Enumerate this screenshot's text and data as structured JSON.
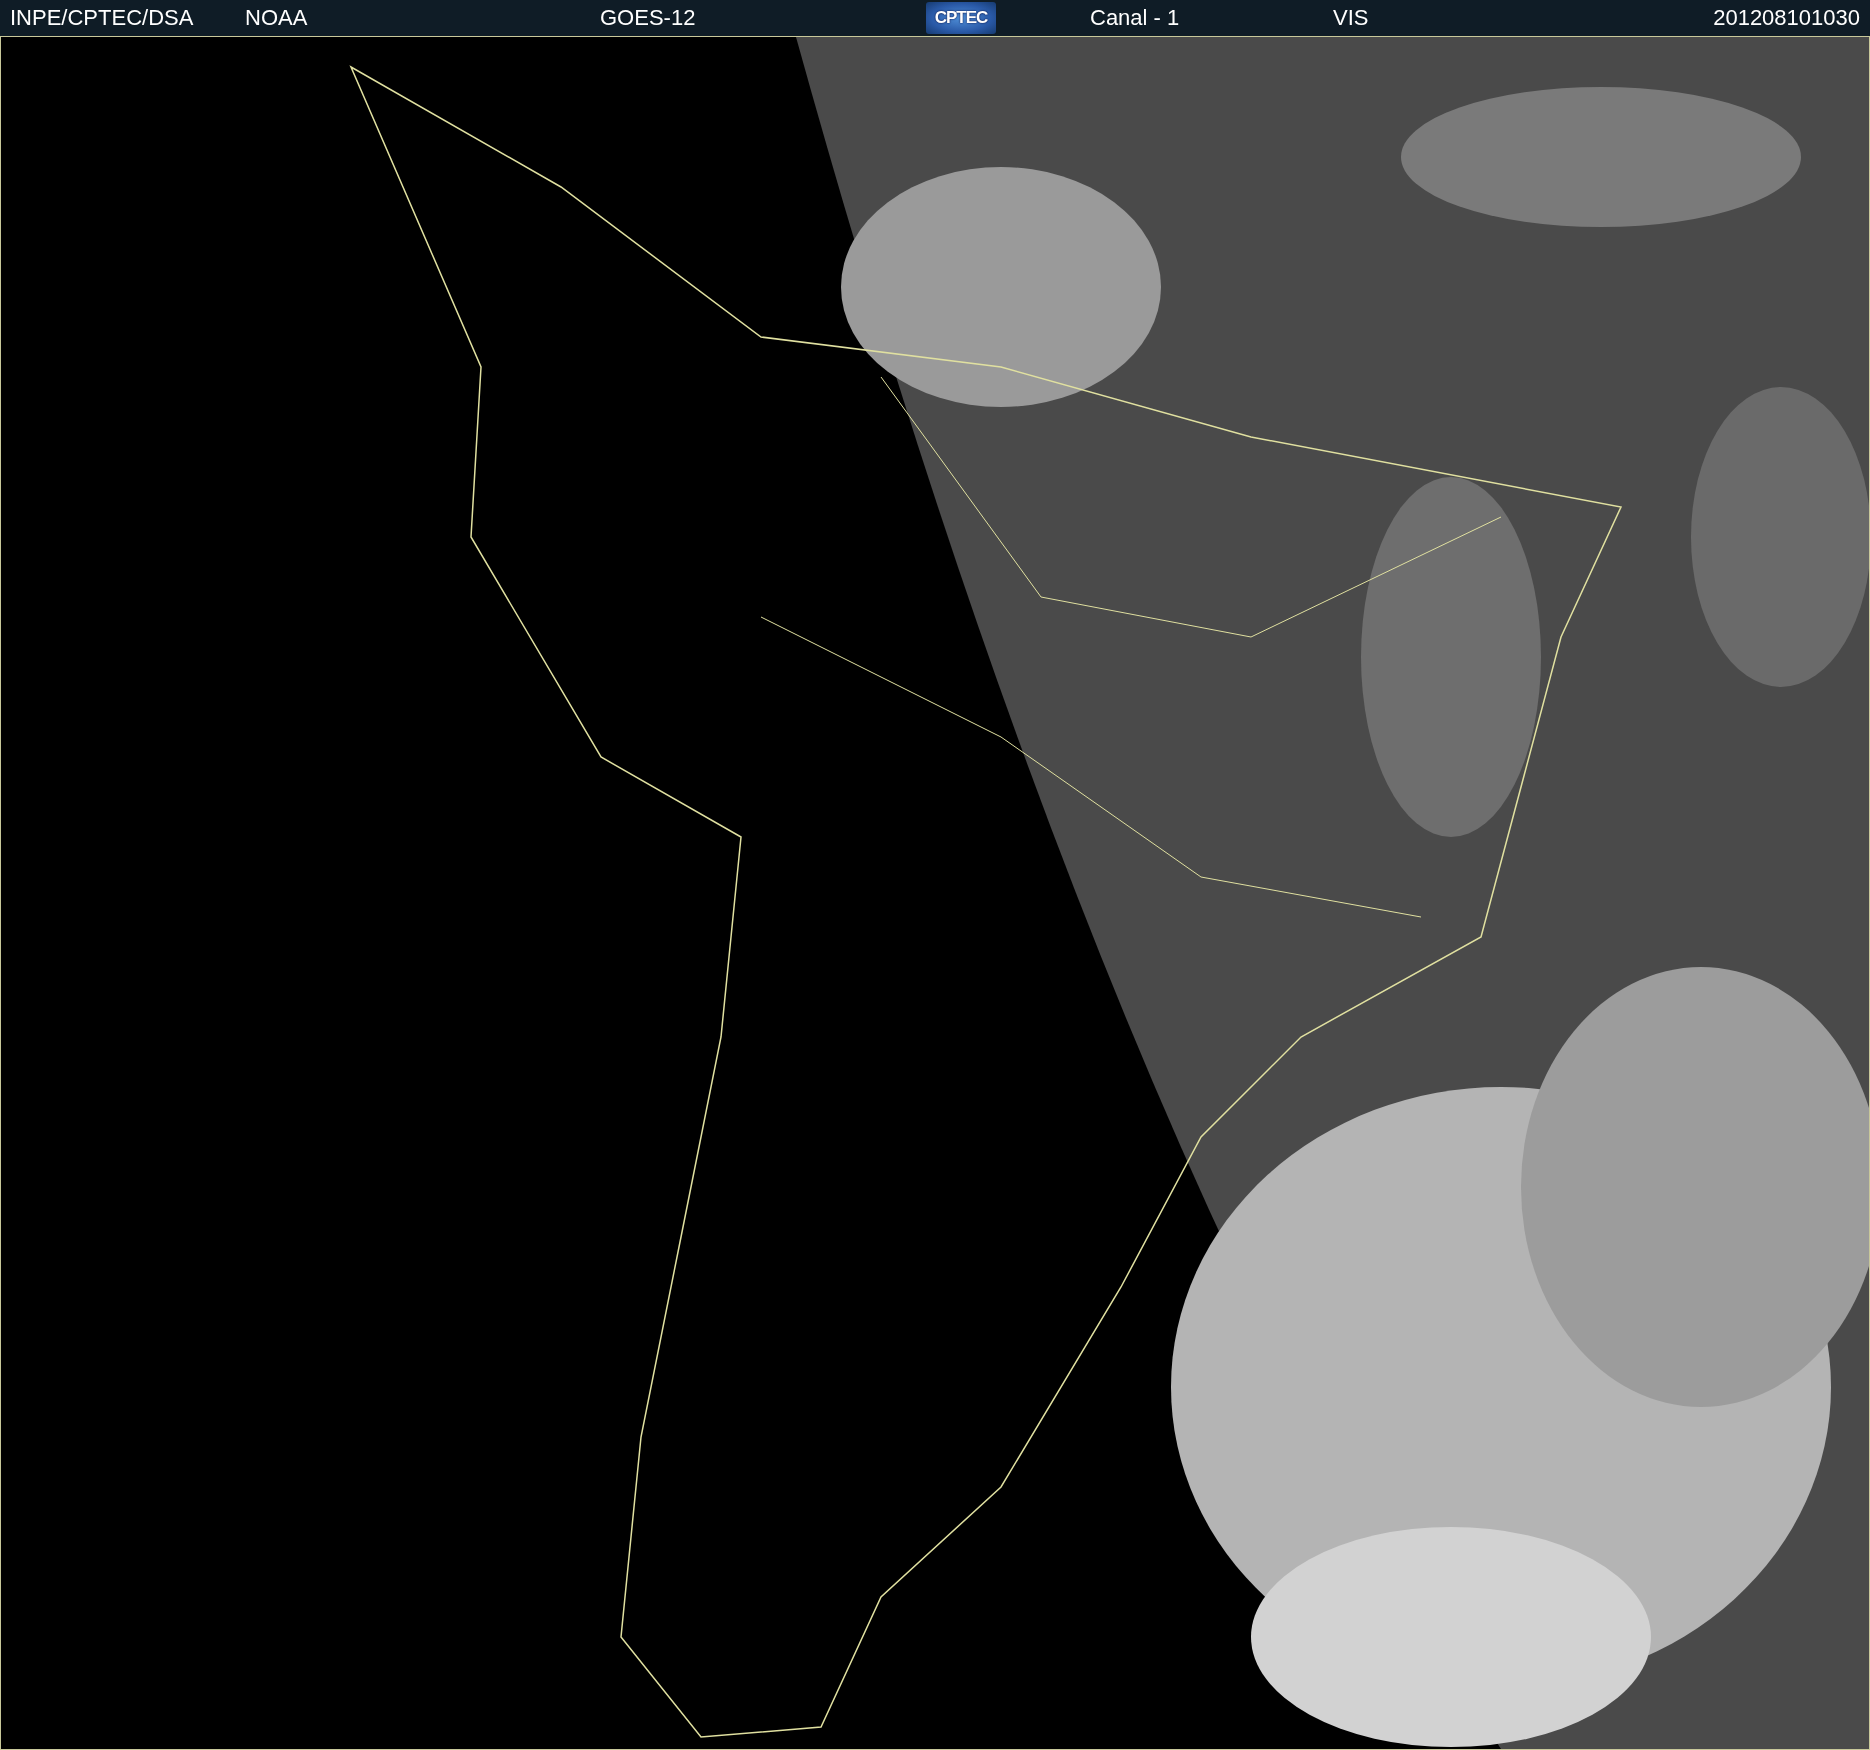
{
  "header": {
    "source": "INPE/CPTEC/DSA",
    "agency": "NOAA",
    "satellite": "GOES-12",
    "logo": "CPTEC",
    "channel": "Canal - 1",
    "band": "VIS",
    "timestamp": "201208101030"
  }
}
